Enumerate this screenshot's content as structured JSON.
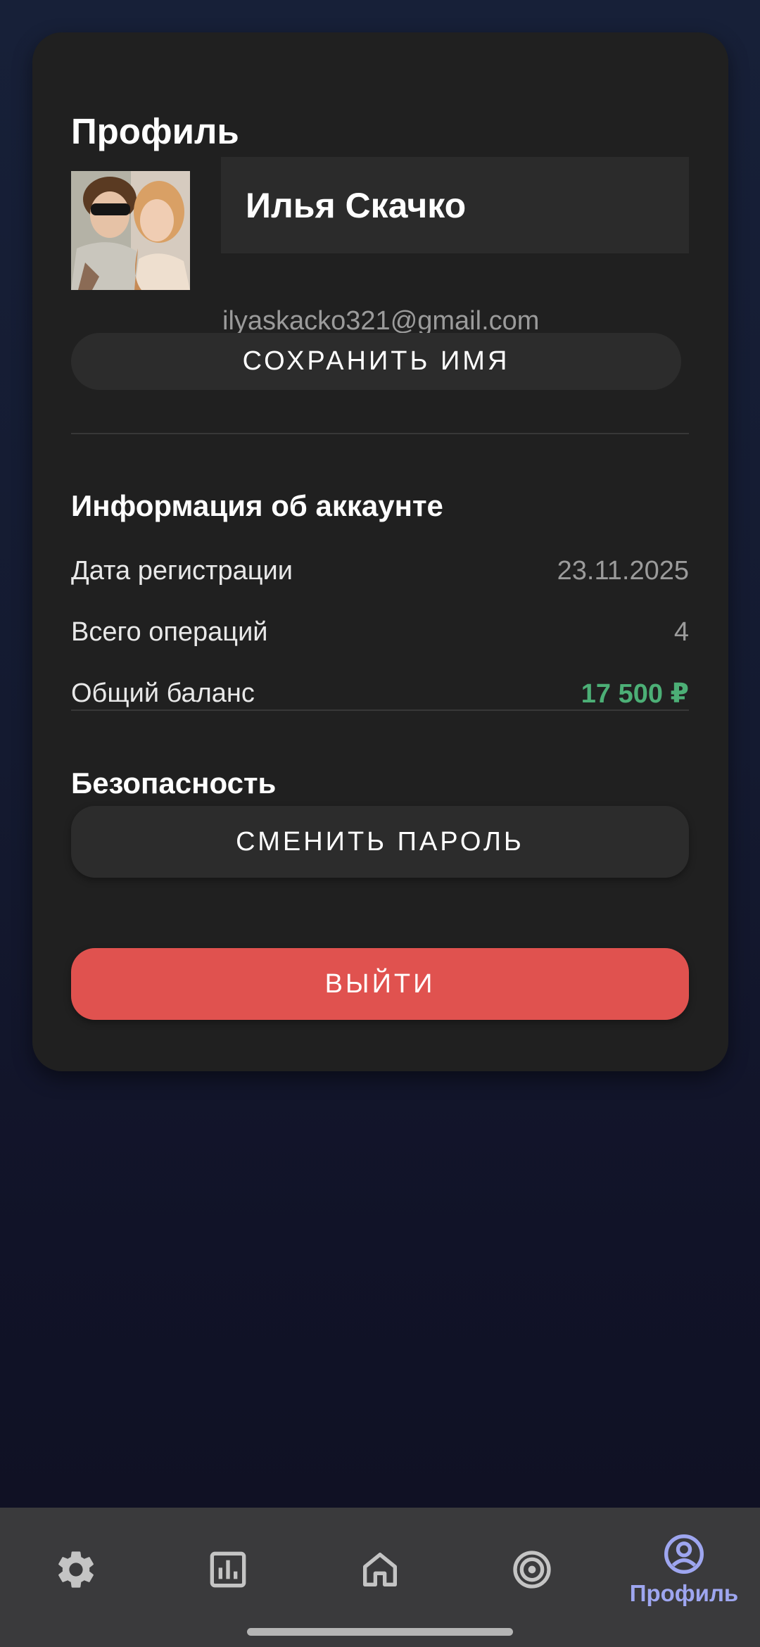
{
  "profile": {
    "title": "Профиль",
    "name_value": "Илья Скачко",
    "email": "ilyaskacko321@gmail.com",
    "save_name_label": "СОХРАНИТЬ ИМЯ"
  },
  "account": {
    "title": "Информация об аккаунте",
    "rows": [
      {
        "label": "Дата регистрации",
        "value": "23.11.2025"
      },
      {
        "label": "Всего операций",
        "value": "4"
      },
      {
        "label": "Общий баланс",
        "value": "17 500 ₽"
      }
    ]
  },
  "security": {
    "title": "Безопасность",
    "change_password_label": "СМЕНИТЬ ПАРОЛЬ"
  },
  "logout_label": "ВЫЙТИ",
  "nav": {
    "items": [
      {
        "icon": "gear-icon",
        "label": ""
      },
      {
        "icon": "chart-icon",
        "label": ""
      },
      {
        "icon": "home-icon",
        "label": ""
      },
      {
        "icon": "target-icon",
        "label": ""
      },
      {
        "icon": "profile-icon",
        "label": "Профиль",
        "active": true
      }
    ]
  },
  "colors": {
    "card": "#202020",
    "accent": "#9ea6f0",
    "balance": "#4caf76",
    "logout": "#e0524f"
  }
}
